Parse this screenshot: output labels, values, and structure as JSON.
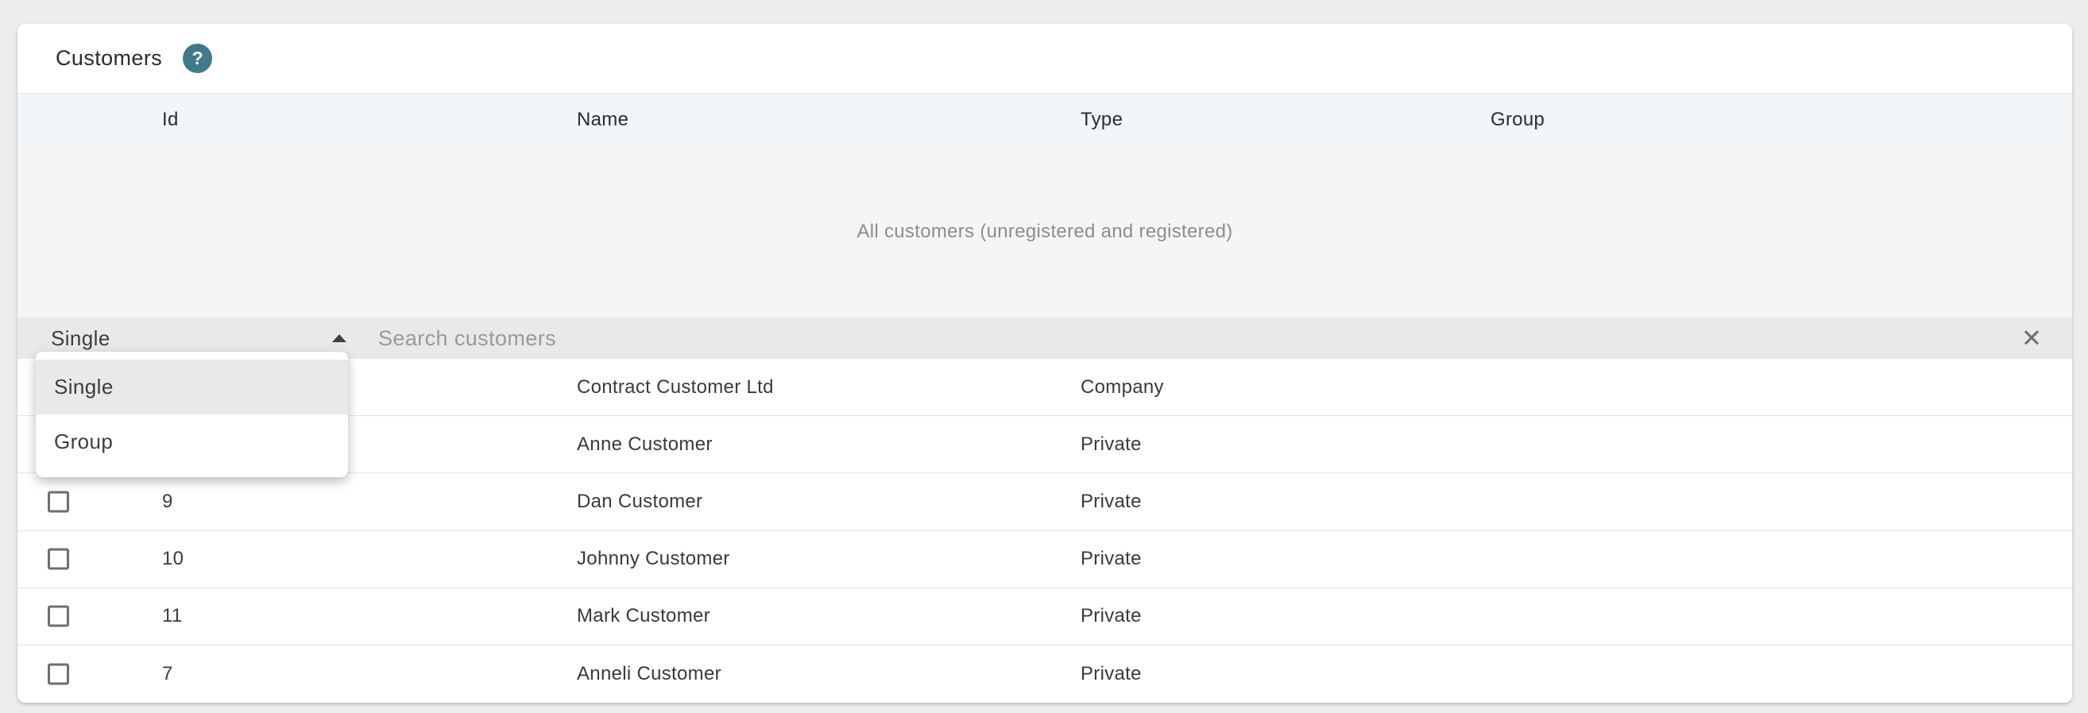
{
  "header": {
    "title": "Customers",
    "help_glyph": "?"
  },
  "table": {
    "columns": [
      {
        "label": "Id"
      },
      {
        "label": "Name"
      },
      {
        "label": "Type"
      },
      {
        "label": "Group"
      }
    ],
    "empty_note": "All customers (unregistered and registered)",
    "rows": [
      {
        "id": "",
        "name": "Contract Customer Ltd",
        "type": "Company",
        "group": "",
        "checkbox": false
      },
      {
        "id": "",
        "name": "Anne Customer",
        "type": "Private",
        "group": "",
        "checkbox": false
      },
      {
        "id": "9",
        "name": "Dan Customer",
        "type": "Private",
        "group": "",
        "checkbox": true
      },
      {
        "id": "10",
        "name": "Johnny Customer",
        "type": "Private",
        "group": "",
        "checkbox": true
      },
      {
        "id": "11",
        "name": "Mark Customer",
        "type": "Private",
        "group": "",
        "checkbox": true
      },
      {
        "id": "7",
        "name": "Anneli Customer",
        "type": "Private",
        "group": "",
        "checkbox": true
      }
    ]
  },
  "filter_bar": {
    "type_value": "Single",
    "search_placeholder": "Search customers",
    "search_value": "",
    "clear_glyph": "✕"
  },
  "dropdown": {
    "options": [
      {
        "label": "Single",
        "selected": true
      },
      {
        "label": "Group",
        "selected": false
      }
    ]
  },
  "colors": {
    "page_bg": "#ededed",
    "help_icon": "#41798c",
    "thead_bg": "#f2f6f8",
    "empty_bg": "#f5f5f6",
    "filter_bar_bg": "#e9e9e9",
    "dropdown_active_bg": "#e9e9e9",
    "row_border": "#e3e3e3",
    "text_dark": "#3a3a3a",
    "text_muted": "#8d8d8d"
  }
}
